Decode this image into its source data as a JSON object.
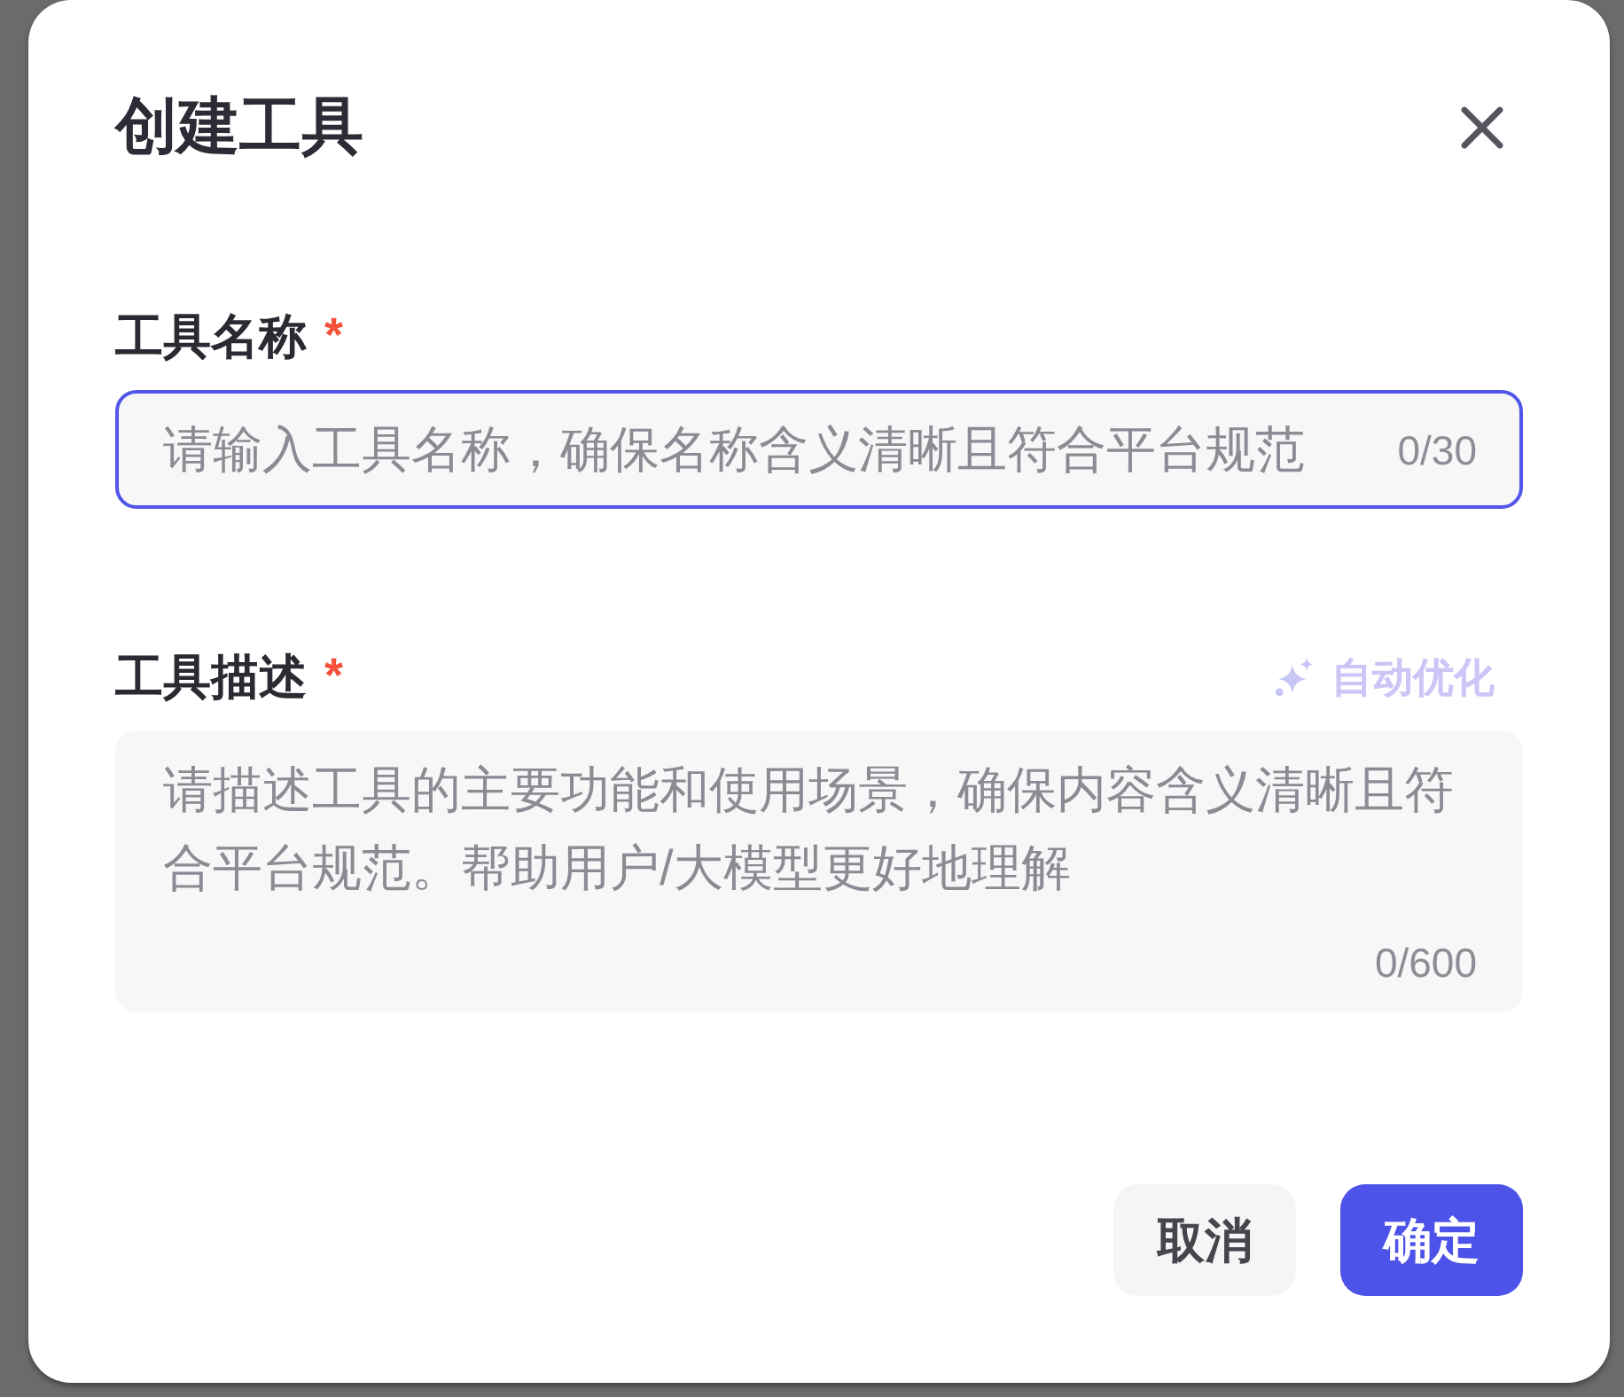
{
  "title": "创建工具",
  "fields": [
    {
      "kind": "input",
      "label": "工具名称",
      "required_mark": "*",
      "placeholder": "请输入工具名称，确保名称含义清晰且符合平台规范",
      "counter": "0/30",
      "focused": true
    },
    {
      "kind": "textarea",
      "label": "工具描述",
      "required_mark": "*",
      "action": {
        "label": "自动优化",
        "disabled": true
      },
      "placeholder": "请描述工具的主要功能和使用场景，确保内容含义清晰且符合平台规范。帮助用户/大模型更好地理解",
      "counter": "0/600",
      "focused": false
    }
  ],
  "buttons": [
    {
      "label": "取消",
      "kind": "secondary"
    },
    {
      "label": "确定",
      "kind": "primary"
    }
  ]
}
